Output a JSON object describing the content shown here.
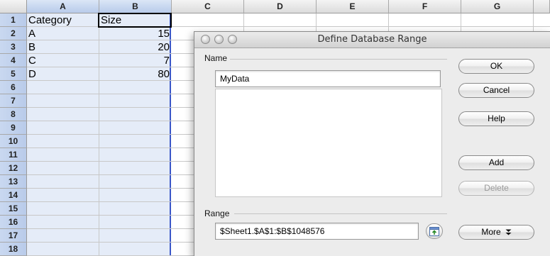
{
  "sheet": {
    "columns": [
      "A",
      "B",
      "C",
      "D",
      "E",
      "F",
      "G"
    ],
    "rows": [
      "1",
      "2",
      "3",
      "4",
      "5",
      "6",
      "7",
      "8",
      "9",
      "10",
      "11",
      "12",
      "13",
      "14",
      "15",
      "16",
      "17",
      "18"
    ],
    "cells": {
      "A1": "Category",
      "B1": "Size",
      "A2": "A",
      "B2": "15",
      "A3": "B",
      "B3": "20",
      "A4": "C",
      "B4": "7",
      "A5": "D",
      "B5": "80"
    }
  },
  "dialog": {
    "title": "Define Database Range",
    "name_label": "Name",
    "name_value": "MyData",
    "range_label": "Range",
    "range_value": "$Sheet1.$A$1:$B$1048576",
    "buttons": {
      "ok": "OK",
      "cancel": "Cancel",
      "help": "Help",
      "add": "Add",
      "delete": "Delete",
      "more": "More"
    },
    "more_icon": "double-chevron-down-icon",
    "shrink_icon": "shrink-dialog-icon"
  }
}
